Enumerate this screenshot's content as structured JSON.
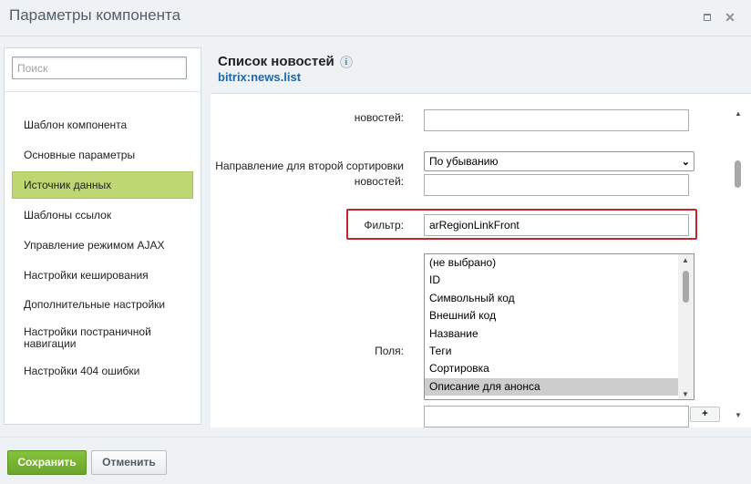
{
  "window": {
    "title": "Параметры компонента"
  },
  "sidebar": {
    "search_placeholder": "Поиск",
    "items": [
      {
        "label": "Шаблон компонента"
      },
      {
        "label": "Основные параметры"
      },
      {
        "label": "Источник данных",
        "active": true
      },
      {
        "label": "Шаблоны ссылок"
      },
      {
        "label": "Управление режимом AJAX"
      },
      {
        "label": "Настройки кеширования"
      },
      {
        "label": "Дополнительные настройки"
      },
      {
        "label": "Настройки постраничной навигации"
      },
      {
        "label": "Настройки 404 ошибки"
      }
    ]
  },
  "main": {
    "title": "Список новостей",
    "info_icon": "i",
    "subtitle": "bitrix:news.list",
    "fields": {
      "top_label_partial": "новостей:",
      "sort2_label_line1": "Направление для второй сортировки",
      "sort2_label_line2": "новостей:",
      "sort2_select_value": "По убыванию",
      "filter_label": "Фильтр:",
      "filter_value": "arRegionLinkFront",
      "fields_label": "Поля:",
      "fields_options": [
        "(не выбрано)",
        "ID",
        "Символьный код",
        "Внешний код",
        "Название",
        "Теги",
        "Сортировка",
        "Описание для анонса"
      ],
      "fields_selected": "Описание для анонса",
      "add_label": "+"
    }
  },
  "footer": {
    "save_label": "Сохранить",
    "cancel_label": "Отменить"
  },
  "colors": {
    "accent_green": "#bed772",
    "save_green": "#78b434",
    "highlight_red": "#c0262c",
    "link_blue": "#1f66a6"
  }
}
